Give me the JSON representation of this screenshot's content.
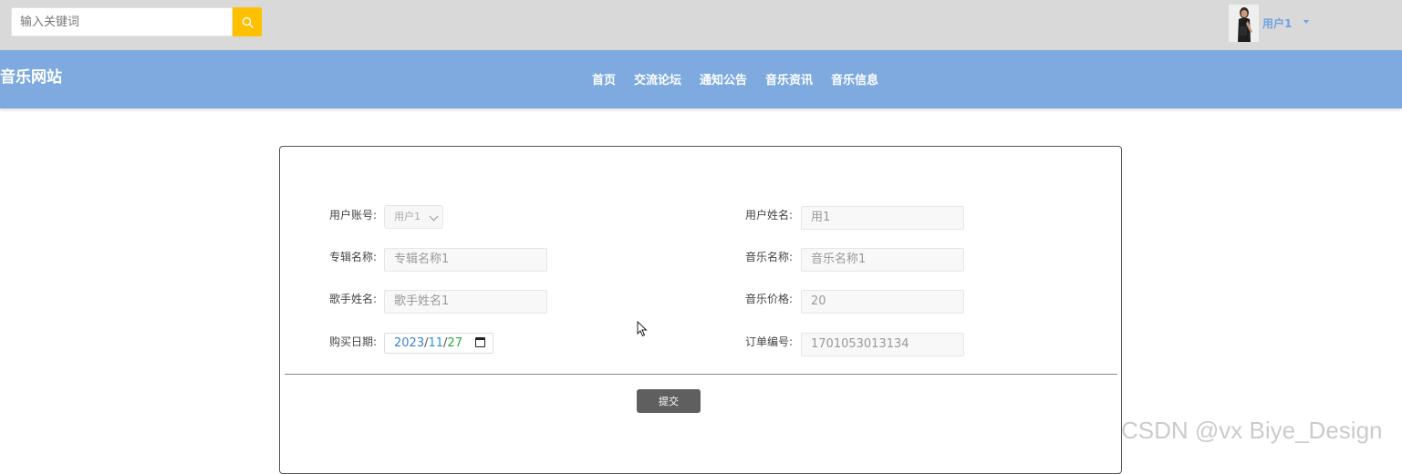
{
  "search": {
    "placeholder": "输入关键词"
  },
  "user": {
    "name": "用户1"
  },
  "site": {
    "title": "音乐网站"
  },
  "nav": [
    {
      "label": "首页"
    },
    {
      "label": "交流论坛"
    },
    {
      "label": "通知公告"
    },
    {
      "label": "音乐资讯"
    },
    {
      "label": "音乐信息"
    }
  ],
  "form": {
    "account_label": "用户账号:",
    "account_value": "用户1",
    "name_label": "用户姓名:",
    "name_value": "用1",
    "album_label": "专辑名称:",
    "album_placeholder": "专辑名称1",
    "music_name_label": "音乐名称:",
    "music_name_placeholder": "音乐名称1",
    "singer_label": "歌手姓名:",
    "singer_placeholder": "歌手姓名1",
    "price_label": "音乐价格:",
    "price_placeholder": "20",
    "date_label": "购买日期:",
    "date_year": "2023",
    "date_month": "11",
    "date_day": "27",
    "order_label": "订单编号:",
    "order_placeholder": "1701053013134",
    "submit_label": "提交"
  },
  "watermark": "CSDN @vx Biye_Design",
  "colors": {
    "topbar": "#d9d9d9",
    "navbar": "#7eaadf",
    "search_button": "#ffc000",
    "submit_button": "#5f5f5f"
  }
}
